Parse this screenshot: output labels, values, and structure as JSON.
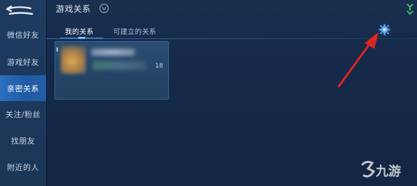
{
  "header": {
    "title": "游戏关系",
    "title_icon": "relation-badge-icon",
    "signal_icon": "signal-icon"
  },
  "sidebar": {
    "back_icon": "back-arrow-icon",
    "items": [
      {
        "label": "微信好友",
        "active": false
      },
      {
        "label": "游戏好友",
        "active": false
      },
      {
        "label": "亲密关系",
        "active": true
      },
      {
        "label": "关注/粉丝",
        "active": false
      },
      {
        "label": "找朋友",
        "active": false
      },
      {
        "label": "附近的人",
        "active": false
      }
    ]
  },
  "tabs": [
    {
      "label": "我的关系",
      "active": true
    },
    {
      "label": "可建立的关系",
      "active": false
    }
  ],
  "settings": {
    "icon": "gear-icon"
  },
  "card": {
    "level_text": "18"
  },
  "watermark": {
    "logo": "jiuyou-logo",
    "text": "九游"
  },
  "colors": {
    "accent": "#2b6fc0",
    "arrow": "#e02424",
    "background": "#15294a"
  }
}
